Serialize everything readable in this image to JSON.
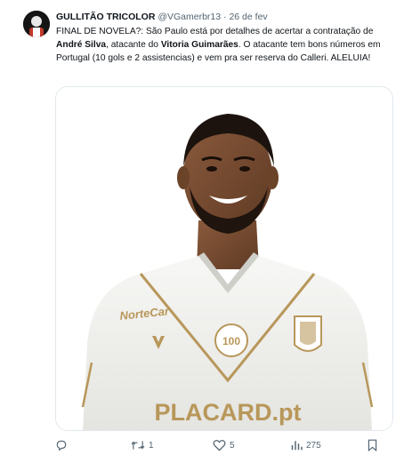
{
  "author": {
    "name": "GULLITÃO TRICOLOR",
    "handle": "@VGamerbr13",
    "separator": "·",
    "date": "26 de fev"
  },
  "tweet": {
    "part1": "FINAL DE NOVELA?: São Paulo está por detalhes de acertar a contratação de ",
    "bold1": "André Silva",
    "part2": ", atacante do ",
    "bold2": "Vitoria Guimarães",
    "part3": ". O atacante tem bons números em Portugal (10 gols e 2 assistencias) e vem pra ser reserva do Calleri. ALELUIA!"
  },
  "media": {
    "sponsor_chest": "PLACARD.pt",
    "sponsor_sleeve": "NorteCar",
    "badge_number": "100"
  },
  "actions": {
    "replies": "",
    "retweets": "1",
    "likes": "5",
    "views": "275"
  },
  "colors": {
    "text": "#0f1419",
    "secondary": "#536471",
    "gold": "#b8975a",
    "shirt": "#f2f2f0"
  },
  "icons": [
    "avatar-image",
    "reply-icon",
    "retweet-icon",
    "like-icon",
    "views-icon",
    "bookmark-icon"
  ]
}
